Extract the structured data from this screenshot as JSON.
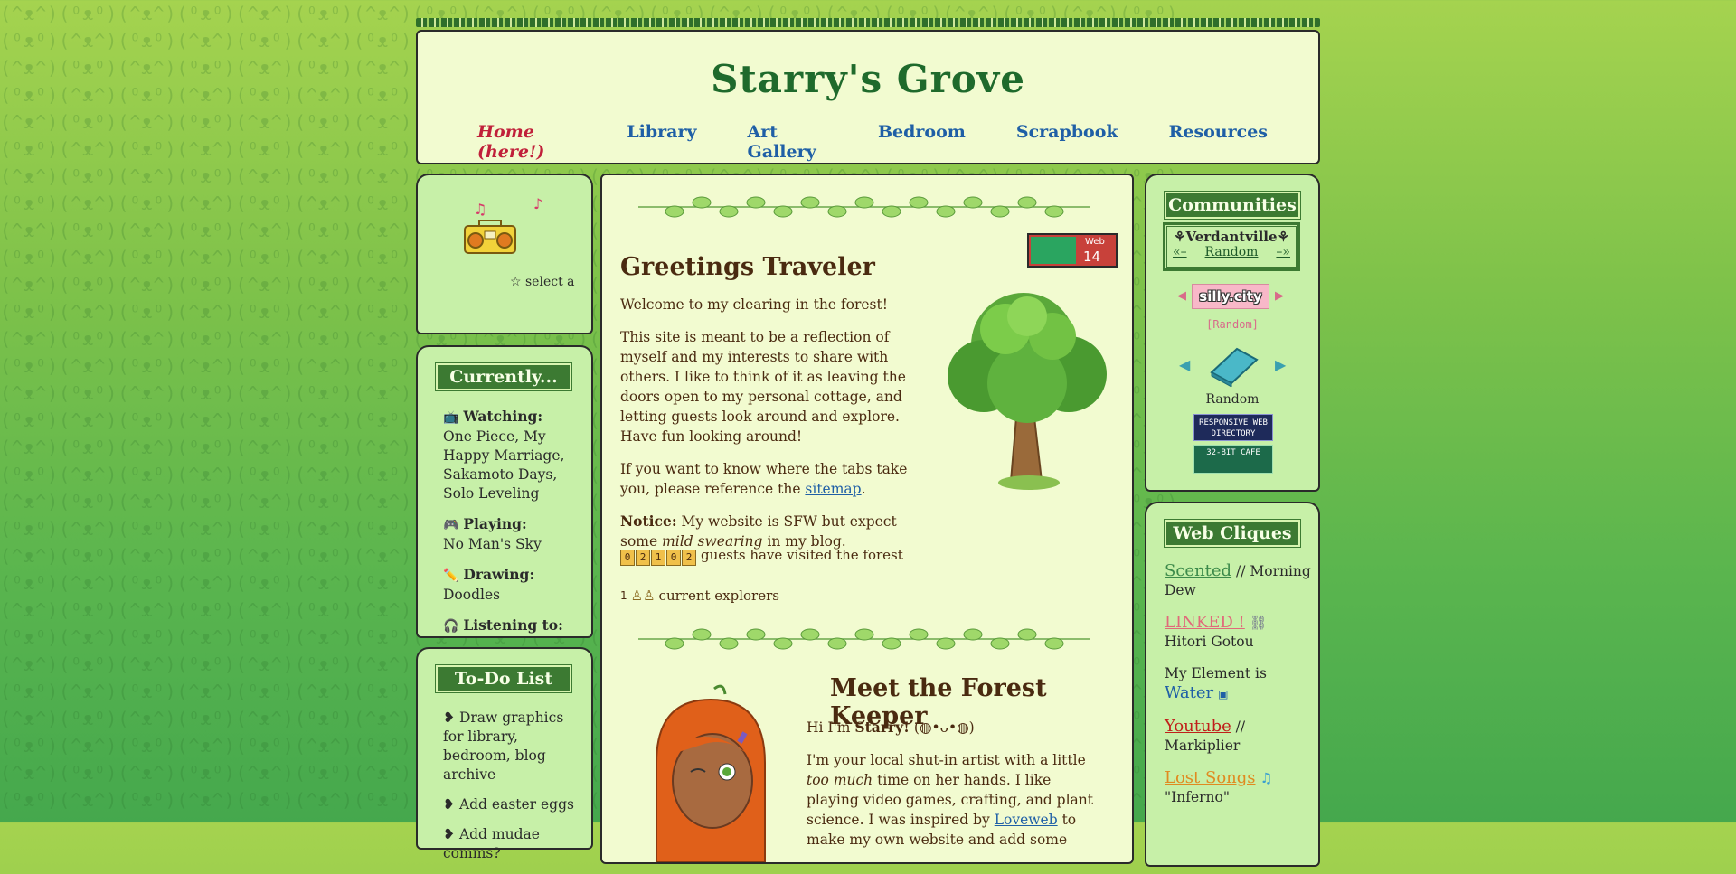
{
  "site": {
    "title": "Starry's Grove"
  },
  "nav": {
    "home": "Home (here!)",
    "library": "Library",
    "art_gallery": "Art Gallery",
    "bedroom": "Bedroom",
    "scrapbook": "Scrapbook",
    "resources": "Resources"
  },
  "music": {
    "select_text": "☆ select a"
  },
  "currently": {
    "title": "Currently...",
    "watching_label": "Watching:",
    "watching_value": "One Piece, My Happy Marriage, Sakamoto Days, Solo Leveling",
    "playing_label": "Playing:",
    "playing_value": "No Man's Sky",
    "drawing_label": "Drawing:",
    "drawing_value": "Doodles",
    "listening_label": "Listening to:"
  },
  "todo": {
    "title": "To-Do List",
    "items": [
      "Draw graphics for library, bedroom, blog archive",
      "Add easter eggs",
      "Add mudae comms?"
    ]
  },
  "greeting": {
    "title": "Greetings Traveler",
    "p1": "Welcome to my clearing in the forest!",
    "p2": "This site is meant to be a reflection of myself and my interests to share with others. I like to think of it as leaving the doors open to my personal cottage, and letting guests look around and explore. Have fun looking around!",
    "p3_pre": "If you want to know where the tabs take you, please reference the ",
    "p3_link": "sitemap",
    "p3_post": ".",
    "notice_label": "Notice:",
    "notice_pre": " My website is SFW but expect some ",
    "notice_em": "mild swearing",
    "notice_post": " in my blog.",
    "visitor_digits": [
      "0",
      "2",
      "1",
      "0",
      "2"
    ],
    "visitor_text": "guests have visited the forest",
    "explorer_count": "1",
    "explorer_text": "current explorers"
  },
  "webbadge": {
    "label": "Web",
    "number": "14"
  },
  "keeper": {
    "title": "Meet the Forest Keeper",
    "intro_pre": "Hi I'm ",
    "intro_name": "Starry!",
    "intro_post": " (◍•ᴗ•◍)",
    "p2_pre": "I'm your local shut-in artist with a little ",
    "p2_em": "too much",
    "p2_mid": " time on her hands. I like playing video games, crafting, and plant science. I was inspired by ",
    "p2_link": "Loveweb",
    "p2_post": " to make my own website and add some"
  },
  "communities": {
    "title": "Communities",
    "verdant_title": "⚘Verdantville⚘",
    "verdant_prev": "«–",
    "verdant_random": "Random",
    "verdant_next": "–»",
    "silly_label": "silly.city",
    "silly_random": "[Random]",
    "book_random": "Random",
    "rwd_button": "RESPONSIVE WEB DIRECTORY",
    "cafe_button": "32-BIT CAFE"
  },
  "cliques": {
    "title": "Web Cliques",
    "items": [
      {
        "link": "Scented",
        "text": " // Morning Dew",
        "color": "#3c8a4a"
      },
      {
        "link": "LINKED !",
        "text": "Hitori Gotou",
        "color": "#e06a7a"
      },
      {
        "pre": "My Element is",
        "link": "Water",
        "color": "#1f5fa6"
      },
      {
        "link": "Youtube",
        "text": " // Markiplier",
        "color": "#c0201a"
      },
      {
        "link": "Lost Songs",
        "text": "\"Inferno\"",
        "color": "#e08a20"
      }
    ]
  },
  "colors": {
    "panel_bg": "#f2fbd0",
    "side_panel_bg": "#c7f0a8",
    "title_bar": "#3c7a32",
    "site_title": "#1f6a2c",
    "link_blue": "#1f5fa6",
    "home_red": "#c0203a"
  }
}
